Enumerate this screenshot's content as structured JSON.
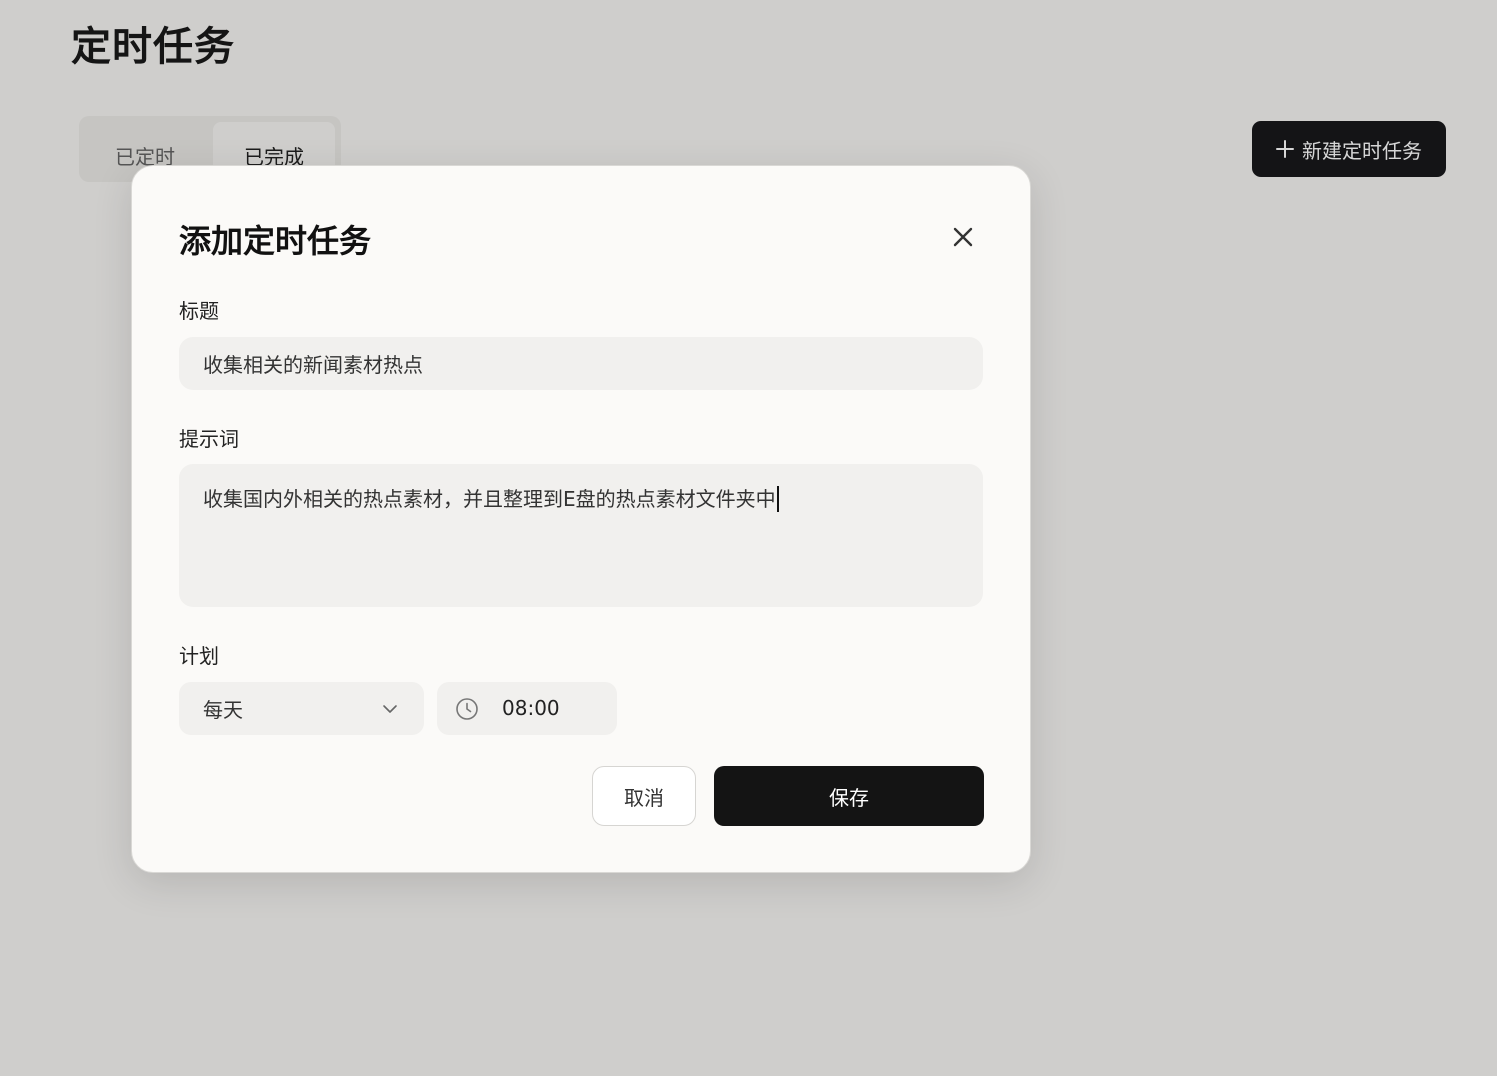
{
  "page": {
    "title": "定时任务",
    "tabs": [
      {
        "label": "已定时",
        "active": false
      },
      {
        "label": "已完成",
        "active": true
      }
    ],
    "new_task_button": "新建定时任务",
    "new_task_icon": "plus-icon"
  },
  "modal": {
    "title": "添加定时任务",
    "close_icon": "close-icon",
    "title_field": {
      "label": "标题",
      "value": "收集相关的新闻素材热点"
    },
    "prompt_field": {
      "label": "提示词",
      "value": "收集国内外相关的热点素材，并且整理到E盘的热点素材文件夹中"
    },
    "plan": {
      "label": "计划",
      "frequency": "每天",
      "frequency_icon": "chevron-down-icon",
      "time": "08:00",
      "time_icon": "clock-icon"
    },
    "cancel_label": "取消",
    "save_label": "保存"
  },
  "colors": {
    "primary_button": "#141414",
    "input_background": "#f1f0ee",
    "modal_background": "#fbfaf8"
  }
}
